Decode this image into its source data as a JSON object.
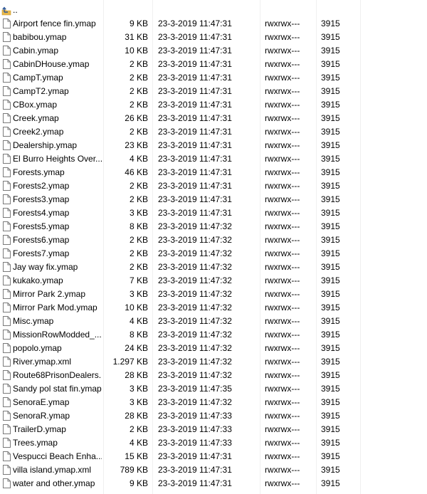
{
  "parent_row": {
    "label": "..",
    "icon": "up-folder-icon"
  },
  "files": [
    {
      "name": "Airport fence fin.ymap",
      "size": "9 KB",
      "modified": "23-3-2019 11:47:31",
      "permissions": "rwxrwx---",
      "owner": "3915"
    },
    {
      "name": "babibou.ymap",
      "size": "31 KB",
      "modified": "23-3-2019 11:47:31",
      "permissions": "rwxrwx---",
      "owner": "3915"
    },
    {
      "name": "Cabin.ymap",
      "size": "10 KB",
      "modified": "23-3-2019 11:47:31",
      "permissions": "rwxrwx---",
      "owner": "3915"
    },
    {
      "name": "CabinDHouse.ymap",
      "size": "2 KB",
      "modified": "23-3-2019 11:47:31",
      "permissions": "rwxrwx---",
      "owner": "3915"
    },
    {
      "name": "CampT.ymap",
      "size": "2 KB",
      "modified": "23-3-2019 11:47:31",
      "permissions": "rwxrwx---",
      "owner": "3915"
    },
    {
      "name": "CampT2.ymap",
      "size": "2 KB",
      "modified": "23-3-2019 11:47:31",
      "permissions": "rwxrwx---",
      "owner": "3915"
    },
    {
      "name": "CBox.ymap",
      "size": "2 KB",
      "modified": "23-3-2019 11:47:31",
      "permissions": "rwxrwx---",
      "owner": "3915"
    },
    {
      "name": "Creek.ymap",
      "size": "26 KB",
      "modified": "23-3-2019 11:47:31",
      "permissions": "rwxrwx---",
      "owner": "3915"
    },
    {
      "name": "Creek2.ymap",
      "size": "2 KB",
      "modified": "23-3-2019 11:47:31",
      "permissions": "rwxrwx---",
      "owner": "3915"
    },
    {
      "name": "Dealership.ymap",
      "size": "23 KB",
      "modified": "23-3-2019 11:47:31",
      "permissions": "rwxrwx---",
      "owner": "3915"
    },
    {
      "name": "El Burro Heights Over...",
      "size": "4 KB",
      "modified": "23-3-2019 11:47:31",
      "permissions": "rwxrwx---",
      "owner": "3915"
    },
    {
      "name": "Forests.ymap",
      "size": "46 KB",
      "modified": "23-3-2019 11:47:31",
      "permissions": "rwxrwx---",
      "owner": "3915"
    },
    {
      "name": "Forests2.ymap",
      "size": "2 KB",
      "modified": "23-3-2019 11:47:31",
      "permissions": "rwxrwx---",
      "owner": "3915"
    },
    {
      "name": "Forests3.ymap",
      "size": "2 KB",
      "modified": "23-3-2019 11:47:31",
      "permissions": "rwxrwx---",
      "owner": "3915"
    },
    {
      "name": "Forests4.ymap",
      "size": "3 KB",
      "modified": "23-3-2019 11:47:31",
      "permissions": "rwxrwx---",
      "owner": "3915"
    },
    {
      "name": "Forests5.ymap",
      "size": "8 KB",
      "modified": "23-3-2019 11:47:32",
      "permissions": "rwxrwx---",
      "owner": "3915"
    },
    {
      "name": "Forests6.ymap",
      "size": "2 KB",
      "modified": "23-3-2019 11:47:32",
      "permissions": "rwxrwx---",
      "owner": "3915"
    },
    {
      "name": "Forests7.ymap",
      "size": "2 KB",
      "modified": "23-3-2019 11:47:32",
      "permissions": "rwxrwx---",
      "owner": "3915"
    },
    {
      "name": "Jay way fix.ymap",
      "size": "2 KB",
      "modified": "23-3-2019 11:47:32",
      "permissions": "rwxrwx---",
      "owner": "3915"
    },
    {
      "name": "kukako.ymap",
      "size": "7 KB",
      "modified": "23-3-2019 11:47:32",
      "permissions": "rwxrwx---",
      "owner": "3915"
    },
    {
      "name": "Mirror Park 2.ymap",
      "size": "3 KB",
      "modified": "23-3-2019 11:47:32",
      "permissions": "rwxrwx---",
      "owner": "3915"
    },
    {
      "name": "Mirror Park Mod.ymap",
      "size": "10 KB",
      "modified": "23-3-2019 11:47:32",
      "permissions": "rwxrwx---",
      "owner": "3915"
    },
    {
      "name": "Misc.ymap",
      "size": "4 KB",
      "modified": "23-3-2019 11:47:32",
      "permissions": "rwxrwx---",
      "owner": "3915"
    },
    {
      "name": "MissionRowModded_...",
      "size": "8 KB",
      "modified": "23-3-2019 11:47:32",
      "permissions": "rwxrwx---",
      "owner": "3915"
    },
    {
      "name": "popolo.ymap",
      "size": "24 KB",
      "modified": "23-3-2019 11:47:32",
      "permissions": "rwxrwx---",
      "owner": "3915"
    },
    {
      "name": "River.ymap.xml",
      "size": "1.297 KB",
      "modified": "23-3-2019 11:47:32",
      "permissions": "rwxrwx---",
      "owner": "3915"
    },
    {
      "name": "Route68PrisonDealers...",
      "size": "28 KB",
      "modified": "23-3-2019 11:47:32",
      "permissions": "rwxrwx---",
      "owner": "3915"
    },
    {
      "name": "Sandy pol stat fin.ymap",
      "size": "3 KB",
      "modified": "23-3-2019 11:47:35",
      "permissions": "rwxrwx---",
      "owner": "3915"
    },
    {
      "name": "SenoraE.ymap",
      "size": "3 KB",
      "modified": "23-3-2019 11:47:32",
      "permissions": "rwxrwx---",
      "owner": "3915"
    },
    {
      "name": "SenoraR.ymap",
      "size": "28 KB",
      "modified": "23-3-2019 11:47:33",
      "permissions": "rwxrwx---",
      "owner": "3915"
    },
    {
      "name": "TrailerD.ymap",
      "size": "2 KB",
      "modified": "23-3-2019 11:47:33",
      "permissions": "rwxrwx---",
      "owner": "3915"
    },
    {
      "name": "Trees.ymap",
      "size": "4 KB",
      "modified": "23-3-2019 11:47:33",
      "permissions": "rwxrwx---",
      "owner": "3915"
    },
    {
      "name": "Vespucci Beach Enha...",
      "size": "15 KB",
      "modified": "23-3-2019 11:47:31",
      "permissions": "rwxrwx---",
      "owner": "3915"
    },
    {
      "name": "villa island.ymap.xml",
      "size": "789 KB",
      "modified": "23-3-2019 11:47:31",
      "permissions": "rwxrwx---",
      "owner": "3915"
    },
    {
      "name": "water and other.ymap",
      "size": "9 KB",
      "modified": "23-3-2019 11:47:31",
      "permissions": "rwxrwx---",
      "owner": "3915"
    }
  ],
  "colors": {
    "divider": "#f0f0f0",
    "text": "#000000",
    "icon_stroke": "#7a7a7a",
    "up_arrow": "#2b579a",
    "folder": "#e8b84a"
  }
}
